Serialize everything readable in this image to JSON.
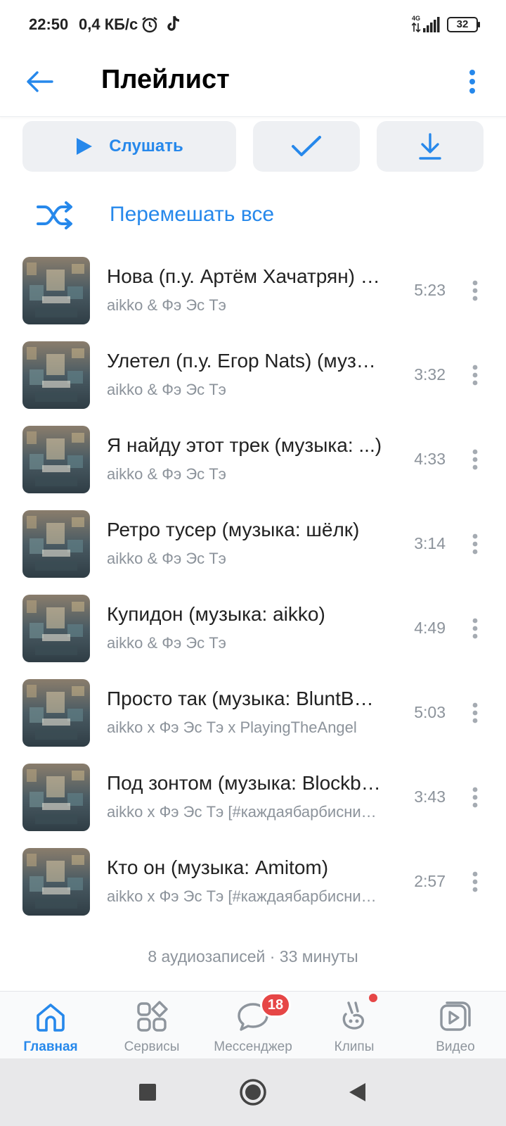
{
  "status_bar": {
    "time": "22:50",
    "speed": "0,4 КБ/с",
    "network": "4G",
    "battery": "32",
    "icons": [
      "alarm-icon",
      "tiktok-icon",
      "signal-icon",
      "battery-icon"
    ]
  },
  "header": {
    "title": "Плейлист",
    "back_icon": "arrow-left-icon",
    "more_icon": "more-vertical-icon"
  },
  "actions": {
    "listen_label": "Слушать",
    "listen_icon": "play-icon",
    "added_icon": "check-icon",
    "download_icon": "download-icon"
  },
  "shuffle": {
    "label": "Перемешать все",
    "icon": "shuffle-icon"
  },
  "tracks": [
    {
      "title": "Нова (п.у. Артём Хачатрян) (музыка: ...)",
      "artist": "aikko & Фэ Эс Тэ",
      "duration": "5:23"
    },
    {
      "title": "Улетел (п.у. Егор Nats) (музыка: ...)",
      "artist": "aikko & Фэ Эс Тэ",
      "duration": "3:32"
    },
    {
      "title": "Я найду этот трек (музыка: ...)",
      "artist": "aikko & Фэ Эс Тэ",
      "duration": "4:33"
    },
    {
      "title": "Ретро тусер (музыка: шёлк)",
      "artist": "aikko & Фэ Эс Тэ",
      "duration": "3:14"
    },
    {
      "title": "Купидон (музыка: aikko)",
      "artist": "aikko & Фэ Эс Тэ",
      "duration": "4:49"
    },
    {
      "title": "Просто так (музыка: BluntBeats)",
      "artist": "aikko x Фэ Эс Тэ x PlayingTheAngel",
      "duration": "5:03"
    },
    {
      "title": "Под зонтом (музыка: Blockbuster)",
      "artist": "aikko x Фэ Эс Тэ [#каждаябарбиснимала]",
      "duration": "3:43"
    },
    {
      "title": "Кто он (музыка: Amitom)",
      "artist": "aikko x Фэ Эс Тэ [#каждаябарбиснимала]",
      "duration": "2:57"
    }
  ],
  "summary": "8 аудиозаписей · 33 минуты",
  "tabbar": {
    "tabs": [
      {
        "label": "Главная",
        "icon": "home-icon",
        "active": true
      },
      {
        "label": "Сервисы",
        "icon": "services-icon",
        "active": false
      },
      {
        "label": "Мессенджер",
        "icon": "messenger-icon",
        "active": false,
        "badge": "18"
      },
      {
        "label": "Клипы",
        "icon": "clips-icon",
        "active": false,
        "dot": true
      },
      {
        "label": "Видео",
        "icon": "video-icon",
        "active": false
      }
    ]
  },
  "system_nav": {
    "icons": [
      "recents-icon",
      "home-circle-icon",
      "back-triangle-icon"
    ]
  },
  "colors": {
    "accent": "#2688eb",
    "secondary_text": "#8c939b",
    "badge": "#e64646"
  }
}
